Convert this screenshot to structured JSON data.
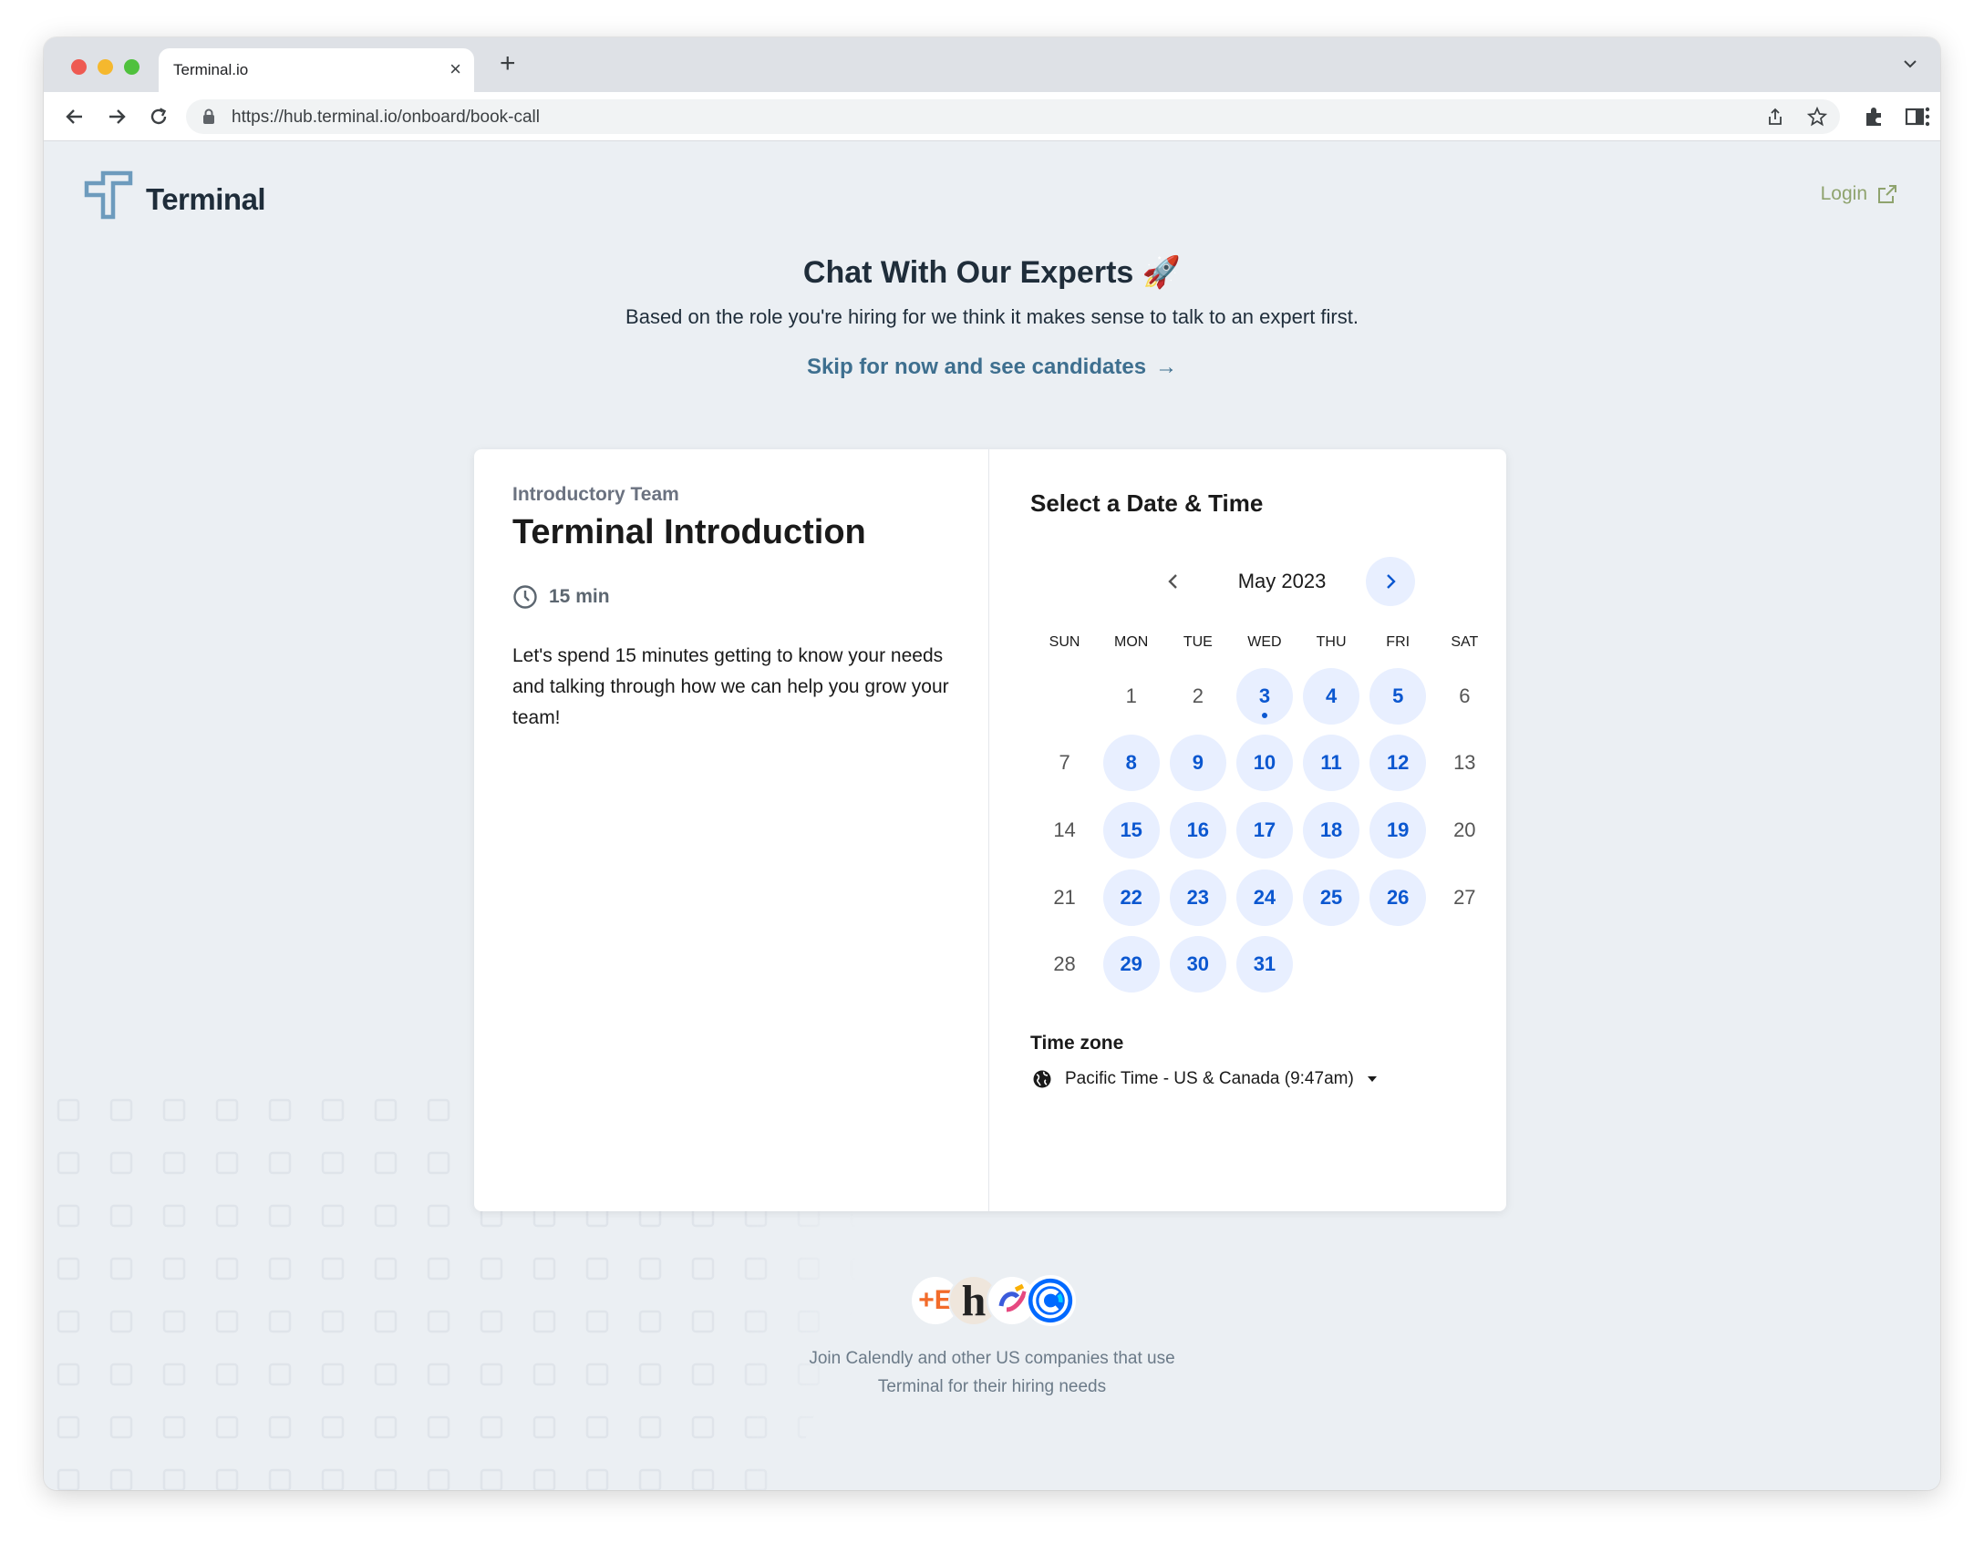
{
  "browser": {
    "tab_title": "Terminal.io",
    "url": "https://hub.terminal.io/onboard/book-call"
  },
  "header": {
    "brand": "Terminal",
    "login_label": "Login"
  },
  "intro": {
    "heading": "Chat With Our Experts 🚀",
    "subheading": "Based on the role you're hiring for we think it makes sense to talk to an expert first.",
    "skip_label": "Skip for now and see candidates"
  },
  "event": {
    "owner": "Introductory Team",
    "title": "Terminal Introduction",
    "duration": "15 min",
    "description": "Let's spend 15 minutes getting to know your needs and talking through how we can help you grow your team!"
  },
  "calendar": {
    "title": "Select a Date & Time",
    "month_label": "May 2023",
    "weekdays": [
      "SUN",
      "MON",
      "TUE",
      "WED",
      "THU",
      "FRI",
      "SAT"
    ],
    "first_weekday_offset": 1,
    "days": [
      {
        "d": "1",
        "available": false
      },
      {
        "d": "2",
        "available": false
      },
      {
        "d": "3",
        "available": true,
        "today": true
      },
      {
        "d": "4",
        "available": true
      },
      {
        "d": "5",
        "available": true
      },
      {
        "d": "6",
        "available": false
      },
      {
        "d": "7",
        "available": false
      },
      {
        "d": "8",
        "available": true
      },
      {
        "d": "9",
        "available": true
      },
      {
        "d": "10",
        "available": true
      },
      {
        "d": "11",
        "available": true
      },
      {
        "d": "12",
        "available": true
      },
      {
        "d": "13",
        "available": false
      },
      {
        "d": "14",
        "available": false
      },
      {
        "d": "15",
        "available": true
      },
      {
        "d": "16",
        "available": true
      },
      {
        "d": "17",
        "available": true
      },
      {
        "d": "18",
        "available": true
      },
      {
        "d": "19",
        "available": true
      },
      {
        "d": "20",
        "available": false
      },
      {
        "d": "21",
        "available": false
      },
      {
        "d": "22",
        "available": true
      },
      {
        "d": "23",
        "available": true
      },
      {
        "d": "24",
        "available": true
      },
      {
        "d": "25",
        "available": true
      },
      {
        "d": "26",
        "available": true
      },
      {
        "d": "27",
        "available": false
      },
      {
        "d": "28",
        "available": false
      },
      {
        "d": "29",
        "available": true
      },
      {
        "d": "30",
        "available": true
      },
      {
        "d": "31",
        "available": true
      }
    ],
    "timezone_label": "Time zone",
    "timezone_value": "Pacific Time - US & Canada (9:47am)"
  },
  "footer": {
    "line1": "Join Calendly and other US companies that use",
    "line2": "Terminal for their hiring needs"
  },
  "colors": {
    "accent": "#0b57d0",
    "available_bg": "#e8efff",
    "login": "#8fa36e",
    "skip_link": "#3e6f8f",
    "page_bg": "#ebeff3"
  }
}
